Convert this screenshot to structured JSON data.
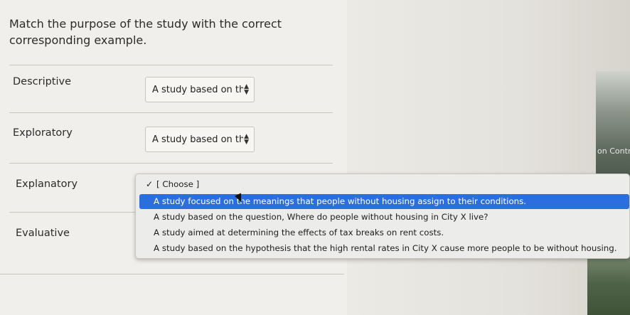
{
  "question": "Match the purpose of the study with the correct corresponding example.",
  "rows": [
    {
      "label": "Descriptive",
      "selected": "A study based on the"
    },
    {
      "label": "Exploratory",
      "selected": "A study based on the"
    },
    {
      "label": "Explanatory"
    },
    {
      "label": "Evaluative"
    }
  ],
  "dropdown": {
    "placeholder": "[ Choose ]",
    "options": [
      "A study focused on the meanings that people without housing assign to their conditions.",
      "A study based on the question, Where do people without housing in City X live?",
      "A study aimed at determining the effects of tax breaks on rent costs.",
      "A study based on the hypothesis that the high rental rates in City X cause more people to be without housing."
    ]
  },
  "background": {
    "edge_text": "on Contr"
  },
  "colors": {
    "highlight": "#2b6fde",
    "panel": "#f1efeb"
  }
}
